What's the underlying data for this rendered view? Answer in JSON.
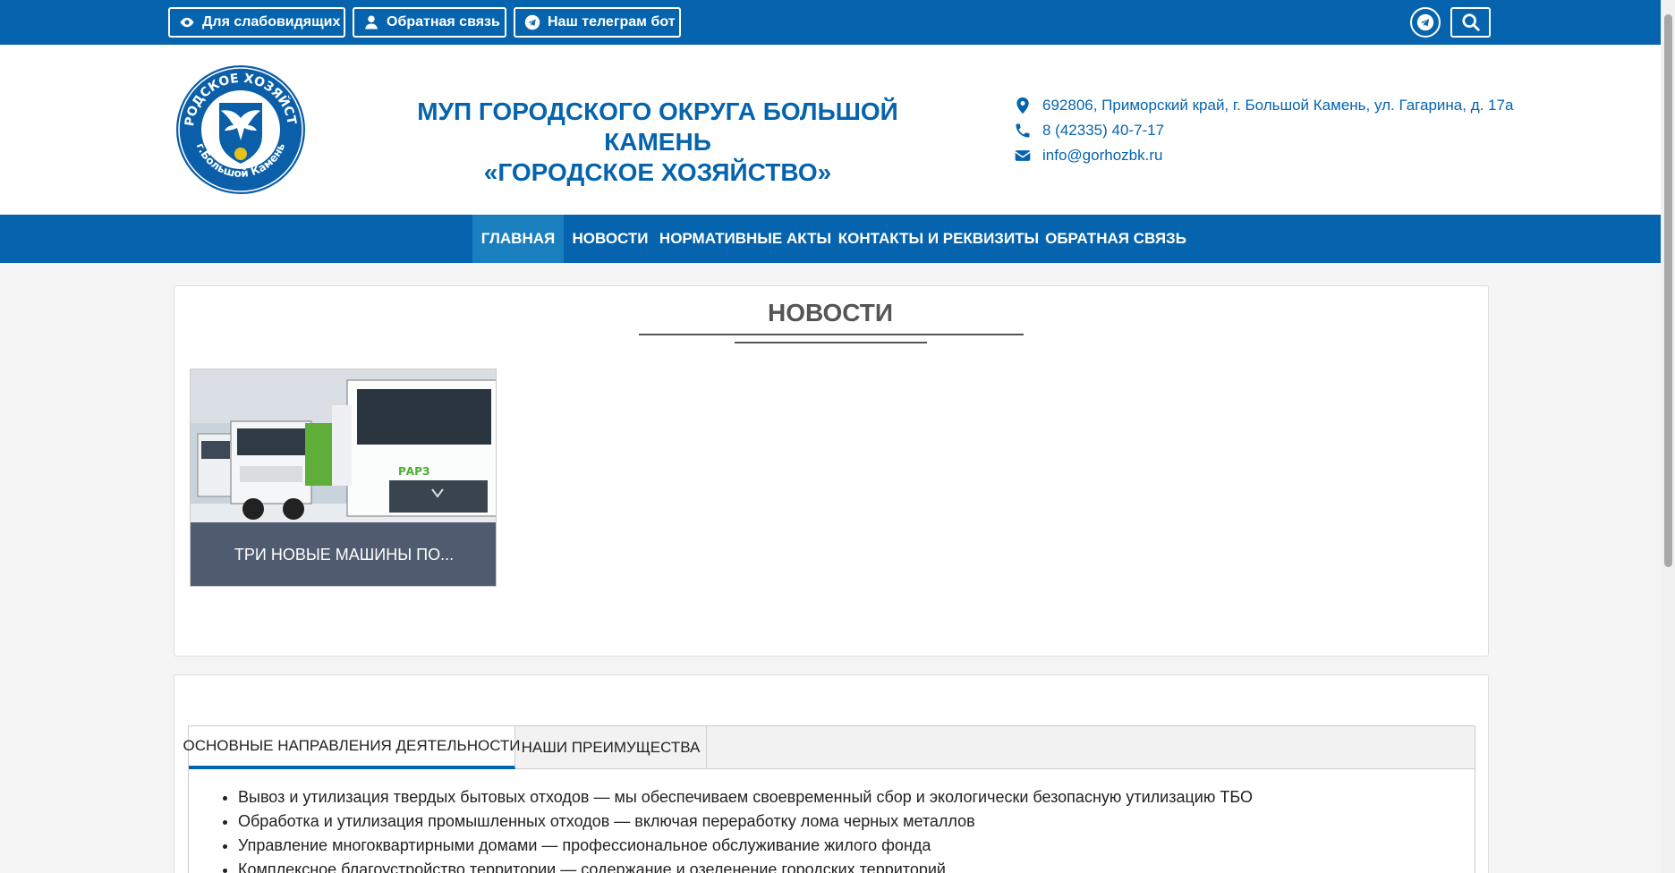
{
  "topbar": {
    "accessibility_label": "Для слабовидящих",
    "feedback_label": "Обратная связь",
    "telegram_bot_label": "Наш телеграм бот"
  },
  "header": {
    "logo_text_top": "ГОРОДСКОЕ ХОЗЯЙСТВО",
    "logo_text_bottom": "г.Большой Камень",
    "title_line1": "МУП ГОРОДСКОГО ОКРУГА БОЛЬШОЙ КАМЕНЬ",
    "title_line2": "«ГОРОДСКОЕ ХОЗЯЙСТВО»",
    "address": "692806, Приморский край, г. Большой Камень, ул. Гагарина, д. 17а",
    "phone": "8 (42335) 40-7-17",
    "email": "info@gorhozbk.ru"
  },
  "nav": {
    "items": [
      {
        "label": "ГЛАВНАЯ"
      },
      {
        "label": "НОВОСТИ"
      },
      {
        "label": "НОРМАТИВНЫЕ АКТЫ"
      },
      {
        "label": "КОНТАКТЫ И РЕКВИЗИТЫ"
      },
      {
        "label": "ОБРАТНАЯ СВЯЗЬ"
      }
    ]
  },
  "news": {
    "title": "НОВОСТИ",
    "cards": [
      {
        "caption": "ТРИ НОВЫЕ МАШИНЫ ПО...",
        "truck_text": "РАРЗ"
      }
    ]
  },
  "tabs": {
    "items": [
      {
        "label": "ОСНОВНЫЕ НАПРАВЛЕНИЯ ДЕЯТЕЛЬНОСТИ"
      },
      {
        "label": "НАШИ ПРЕИМУЩЕСТВА"
      }
    ],
    "activities": [
      "Вывоз и утилизация твердых бытовых отходов — мы обеспечиваем своевременный сбор и экологически безопасную утилизацию ТБО",
      "Обработка и утилизация промышленных отходов — включая переработку лома черных металлов",
      "Управление многоквартирными домами — профессиональное обслуживание жилого фонда",
      "Комплексное благоустройство территории — содержание и озеленение городских территорий"
    ]
  },
  "colors": {
    "brand_blue": "#0564ad",
    "nav_active": "#1a7fbf",
    "card_caption_bg": "#4f5c70"
  }
}
